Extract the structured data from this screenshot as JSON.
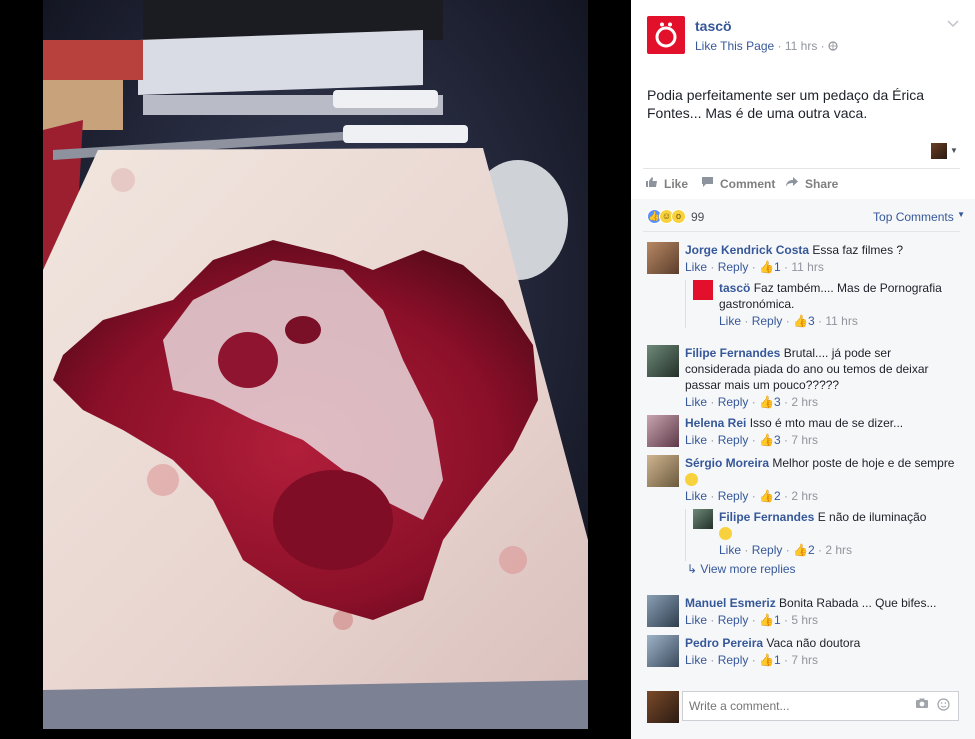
{
  "post": {
    "page_name": "tascö",
    "like_page": "Like This Page",
    "time": "11 hrs",
    "text": "Podia perfeitamente ser um pedaço da Érica Fontes... Mas é de uma outra vaca."
  },
  "actions": {
    "like": "Like",
    "comment": "Comment",
    "share": "Share"
  },
  "reactions": {
    "count": "99",
    "sort_label": "Top Comments"
  },
  "comments": [
    {
      "name": "Jorge Kendrick Costa",
      "text": "Essa faz filmes ?",
      "like": "Like",
      "reply": "Reply",
      "likes": "1",
      "time": "11 hrs"
    },
    {
      "name": "tascö",
      "text": "Faz também.... Mas de Pornografia gastronómica.",
      "like": "Like",
      "reply": "Reply",
      "likes": "3",
      "time": "11 hrs"
    },
    {
      "name": "Filipe Fernandes",
      "text": "Brutal.... já pode ser considerada piada do ano ou temos de deixar passar mais um pouco?????",
      "like": "Like",
      "reply": "Reply",
      "likes": "3",
      "time": "2 hrs"
    },
    {
      "name": "Helena Rei",
      "text": "Isso é mto mau de se dizer...",
      "like": "Like",
      "reply": "Reply",
      "likes": "3",
      "time": "7 hrs"
    },
    {
      "name": "Sérgio Moreira",
      "text": "Melhor poste de hoje e de sempre",
      "like": "Like",
      "reply": "Reply",
      "likes": "2",
      "time": "2 hrs"
    },
    {
      "name": "Filipe Fernandes",
      "text": "E não de iluminação",
      "like": "Like",
      "reply": "Reply",
      "likes": "2",
      "time": "2 hrs"
    },
    {
      "name": "Manuel Esmeriz",
      "text": "Bonita Rabada ... Que bifes...",
      "like": "Like",
      "reply": "Reply",
      "likes": "1",
      "time": "5 hrs"
    },
    {
      "name": "Pedro Pereira",
      "text": "Vaca não doutora",
      "like": "Like",
      "reply": "Reply",
      "likes": "1",
      "time": "7 hrs"
    }
  ],
  "view_more": "View more replies",
  "write": {
    "placeholder": "Write a comment..."
  },
  "icons": {
    "page_logo": "tasco-logo-icon",
    "globe": "globe-icon",
    "chevron": "chevron-down-icon",
    "thumb": "thumbs-up-icon",
    "camera": "camera-icon",
    "emoji": "smiley-icon"
  },
  "colors": {
    "link": "#365899",
    "brand": "#e3102b",
    "meta": "#90949c"
  }
}
